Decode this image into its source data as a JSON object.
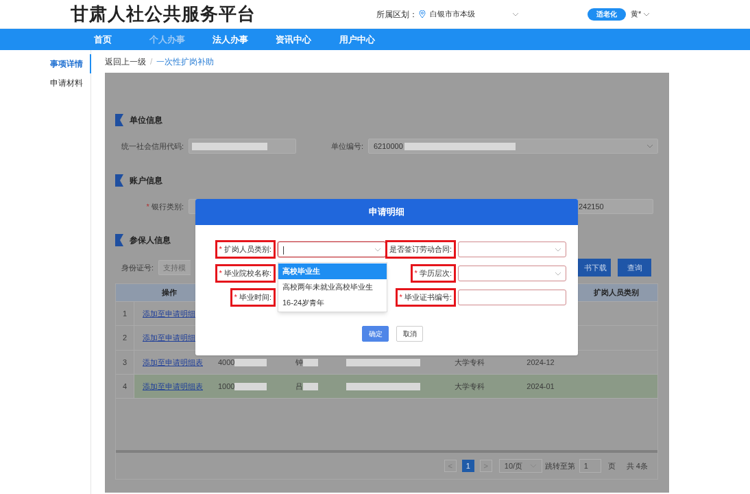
{
  "header": {
    "title": "甘肃人社公共服务平台",
    "region_label": "所属区划：",
    "region_value": "白银市市本级",
    "elder_button": "适老化",
    "user": "黄*"
  },
  "nav": [
    {
      "label": "首页",
      "selected": false
    },
    {
      "label": "个人办事",
      "selected": true
    },
    {
      "label": "法人办事",
      "selected": false
    },
    {
      "label": "资讯中心",
      "selected": false
    },
    {
      "label": "用户中心",
      "selected": false
    }
  ],
  "sidebar": [
    {
      "label": "事项详情",
      "selected": true
    },
    {
      "label": "申请材料",
      "selected": false
    }
  ],
  "breadcrumb": {
    "back": "返回上一级",
    "separator": "/",
    "current": "一次性扩岗补助"
  },
  "sections": [
    {
      "title": "单位信息"
    },
    {
      "title": "账户信息"
    },
    {
      "title": "参保人信息"
    }
  ],
  "unit": {
    "credit_code_label": "统一社会信用代码:",
    "unit_no_label": "单位编号:",
    "unit_no_value": "6210000"
  },
  "account": {
    "bank_label": "银行类别:",
    "bank_star": "*",
    "account_tail": "242150"
  },
  "insured": {
    "id_label": "身份证号:",
    "id_placeholder": "支持模",
    "download_button": "书下载",
    "query_button": "查询"
  },
  "table": {
    "columns": [
      {
        "kind": "operation",
        "label": "操作"
      },
      {
        "kind": "category",
        "label": "扩岗人员类别"
      }
    ],
    "rows": [
      {
        "index": "1",
        "link": "添加至申请明细",
        "selected": false
      },
      {
        "index": "2",
        "link": "添加至申请明细",
        "selected": false
      },
      {
        "index": "3",
        "link": "添加至申请明细表",
        "selected": false,
        "column_3": "4000",
        "column_4": "钟",
        "column_6": "大学专科",
        "column_7": "2024-12"
      },
      {
        "index": "4",
        "link": "添加至申请明细表",
        "selected": true,
        "column_3": "1000",
        "column_4": "吕",
        "column_6": "大学专科",
        "column_7": "2024-01"
      }
    ]
  },
  "pagination": {
    "prev": "<",
    "pages": [
      {
        "label": "1",
        "selected": true
      }
    ],
    "next": ">",
    "page_size": "10/页",
    "jump_label": "跳转至第",
    "jump_value": "1",
    "page_unit": "页",
    "total": "共 4条"
  },
  "dialog": {
    "title": "申请明细",
    "fields": [
      {
        "kind": "select",
        "label": "扩岗人员类别:",
        "star": "*",
        "highlighted": true,
        "value": "|",
        "focused": true
      },
      {
        "kind": "select",
        "label": "是否签订劳动合同:",
        "highlighted": true,
        "focused": false
      },
      {
        "kind": "input",
        "label": "毕业院校名称:",
        "star": "*",
        "highlighted": true,
        "focused": false
      },
      {
        "kind": "select",
        "label": "学历层次:",
        "star": "*",
        "highlighted": true,
        "focused": false
      },
      {
        "kind": "input",
        "label": "毕业时间:",
        "star": "*",
        "highlighted": true,
        "focused": false
      },
      {
        "kind": "input",
        "label": "毕业证书编号:",
        "star": "*",
        "highlighted": true,
        "focused": false
      }
    ],
    "dropdown": [
      {
        "label": "高校毕业生",
        "selected": true
      },
      {
        "label": "高校两年未就业高校毕业生",
        "selected": false
      },
      {
        "label": "16-24岁青年",
        "selected": false
      }
    ],
    "buttons": [
      {
        "kind": "primary",
        "label": "确定"
      },
      {
        "kind": "default",
        "label": "取消"
      }
    ]
  }
}
